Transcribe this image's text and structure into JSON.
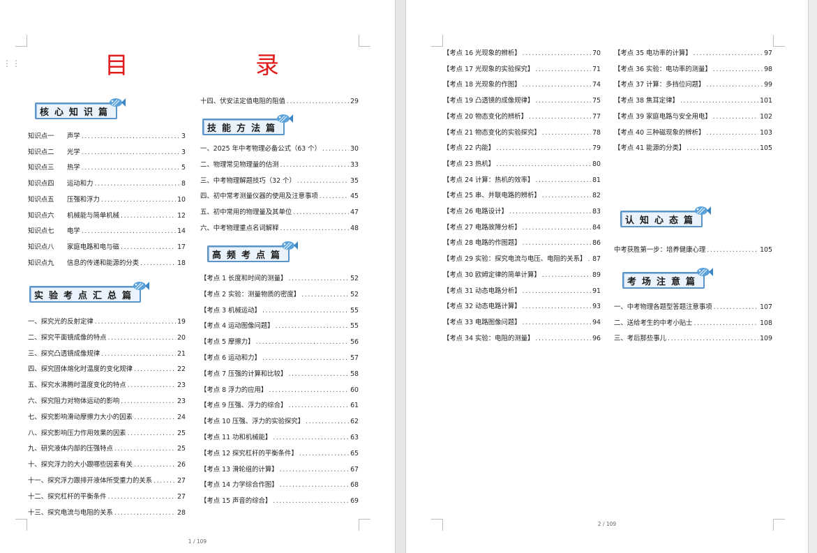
{
  "title": "目　　录",
  "page1": {
    "page_number": "1 / 109",
    "sections": {
      "core": "核心知识篇",
      "experiment": "实验考点汇总篇",
      "skills": "技能方法篇",
      "high_freq": "高频考点篇"
    },
    "knowledge": [
      {
        "label": "知识点一",
        "title": "声学",
        "page": "3"
      },
      {
        "label": "知识点二",
        "title": "光学",
        "page": "3"
      },
      {
        "label": "知识点三",
        "title": "热学",
        "page": "5"
      },
      {
        "label": "知识点四",
        "title": "运动和力",
        "page": "8"
      },
      {
        "label": "知识点五",
        "title": "压强和浮力",
        "page": "10"
      },
      {
        "label": "知识点六",
        "title": "机械能与简单机械",
        "page": "12"
      },
      {
        "label": "知识点七",
        "title": "电学",
        "page": "14"
      },
      {
        "label": "知识点八",
        "title": "家庭电路和电与磁",
        "page": "17"
      },
      {
        "label": "知识点九",
        "title": "信息的传递和能源的分类",
        "page": "18"
      }
    ],
    "experiments": [
      {
        "title": "一、探究光的反射定律",
        "page": "19"
      },
      {
        "title": "二、探究平面镜成像的特点",
        "page": "20"
      },
      {
        "title": "三、探究凸透镜成像规律",
        "page": "21"
      },
      {
        "title": "四、探究固体熔化时温度的变化规律",
        "page": "22"
      },
      {
        "title": "五、探究水沸腾时温度变化的特点",
        "page": "23"
      },
      {
        "title": "六、探究阻力对物体运动的影响",
        "page": "23"
      },
      {
        "title": "七、探究影响滑动摩擦力大小的因素",
        "page": "24"
      },
      {
        "title": "八、探究影响压力作用效果的因素",
        "page": "25"
      },
      {
        "title": "九、研究液体内部的压强特点",
        "page": "25"
      },
      {
        "title": "十、探究浮力的大小跟哪些因素有关",
        "page": "26"
      },
      {
        "title": "十一、探究浮力跟排开液体所受重力的关系",
        "page": "27"
      },
      {
        "title": "十二、探究杠杆的平衡条件",
        "page": "27"
      },
      {
        "title": "十三、探究电流与电阻的关系",
        "page": "28"
      },
      {
        "title": "十四、伏安法定值电阻的阻值",
        "page": "29"
      }
    ],
    "skills": [
      {
        "title": "一、2025 年中考物理必备公式（63 个）",
        "page": "30"
      },
      {
        "title": "二、物理常见物理量的估测",
        "page": "33"
      },
      {
        "title": "三、中考物理解题技巧（32 个）",
        "page": "35"
      },
      {
        "title": "四、初中常考测量仪器的使用及注意事项",
        "page": "45"
      },
      {
        "title": "五、初中常用的物理量及其单位",
        "page": "47"
      },
      {
        "title": "六、中考物理重点名词解释",
        "page": "48"
      }
    ],
    "points": [
      {
        "title": "【考点 1 长度和时间的测量】",
        "page": "52"
      },
      {
        "title": "【考点 2 实验：测量物质的密度】",
        "page": "52"
      },
      {
        "title": "【考点 3 机械运动】",
        "page": "55"
      },
      {
        "title": "【考点 4 运动图像问题】",
        "page": "55"
      },
      {
        "title": "【考点 5 摩擦力】",
        "page": "56"
      },
      {
        "title": "【考点 6 运动和力】",
        "page": "57"
      },
      {
        "title": "【考点 7 压强的计算和比较】",
        "page": "58"
      },
      {
        "title": "【考点 8 浮力的应用】",
        "page": "60"
      },
      {
        "title": "【考点 9 压强、浮力的综合】",
        "page": "61"
      },
      {
        "title": "【考点 10 压强、浮力的实验探究】",
        "page": "62"
      },
      {
        "title": "【考点 11 功和机械能】",
        "page": "63"
      },
      {
        "title": "【考点 12 探究杠杆的平衡条件】",
        "page": "65"
      },
      {
        "title": "【考点 13 滑轮组的计算】",
        "page": "67"
      },
      {
        "title": "【考点 14 力学综合作图】",
        "page": "68"
      },
      {
        "title": "【考点 15 声音的综合】",
        "page": "69"
      }
    ]
  },
  "page2": {
    "page_number": "2 / 109",
    "sections": {
      "mindset": "认知心态篇",
      "exam_hall": "考场注意篇"
    },
    "points_left": [
      {
        "title": "【考点 16 光现象的辨析】",
        "page": "70"
      },
      {
        "title": "【考点 17 光现象的实验探究】",
        "page": "71"
      },
      {
        "title": "【考点 18 光现象的作图】",
        "page": "74"
      },
      {
        "title": "【考点 19 凸透镜的成像规律】",
        "page": "75"
      },
      {
        "title": "【考点 20 物态变化的辨析】",
        "page": "77"
      },
      {
        "title": "【考点 21 物态变化的实验探究】",
        "page": "78"
      },
      {
        "title": "【考点 22 内能】",
        "page": "79"
      },
      {
        "title": "【考点 23 热机】",
        "page": "80"
      },
      {
        "title": "【考点 24 计算：热机的效率】",
        "page": "81"
      },
      {
        "title": "【考点 25 串、并联电路的辨析】",
        "page": "82"
      },
      {
        "title": "【考点 26 电路设计】",
        "page": "83"
      },
      {
        "title": "【考点 27 电路故障分析】",
        "page": "84"
      },
      {
        "title": "【考点 28 电路的作图题】",
        "page": "86"
      },
      {
        "title": "【考点 29 实验：探究电流与电压、电阻的关系】",
        "page": "87"
      },
      {
        "title": "【考点 30 欧姆定律的简单计算】",
        "page": "89"
      },
      {
        "title": "【考点 31 动态电路分析】",
        "page": "91"
      },
      {
        "title": "【考点 32 动态电路计算】",
        "page": "93"
      },
      {
        "title": "【考点 33 电路图像问题】",
        "page": "94"
      },
      {
        "title": "【考点 34 实验：电阻的测量】",
        "page": "96"
      }
    ],
    "points_right": [
      {
        "title": "【考点 35 电功率的计算】",
        "page": "97"
      },
      {
        "title": "【考点 36 实验：电功率的测量】",
        "page": "98"
      },
      {
        "title": "【考点 37 计算：多挡位问题】",
        "page": "99"
      },
      {
        "title": "【考点 38 焦耳定律】",
        "page": "101"
      },
      {
        "title": "【考点 39 家庭电路与安全用电】",
        "page": "102"
      },
      {
        "title": "【考点 40 三种磁现象的辨析】",
        "page": "103"
      },
      {
        "title": "【考点 41 能源的分类】",
        "page": "105"
      }
    ],
    "mindset": [
      {
        "title": "中考获胜第一步：培养健康心理",
        "page": "105"
      }
    ],
    "exam_hall": [
      {
        "title": "一、中考物理各题型答题注意事项",
        "page": "107"
      },
      {
        "title": "二、送给考生的中考小贴士",
        "page": "108"
      },
      {
        "title": "三、考后那些事儿",
        "page": "109"
      }
    ]
  },
  "icons": {
    "section_badge": "fish-icon",
    "drag": "drag-handle-icon"
  },
  "colors": {
    "title": "#e21d1d",
    "badge_border": "#5a94c8",
    "badge_fill": "#eaf3fb"
  }
}
